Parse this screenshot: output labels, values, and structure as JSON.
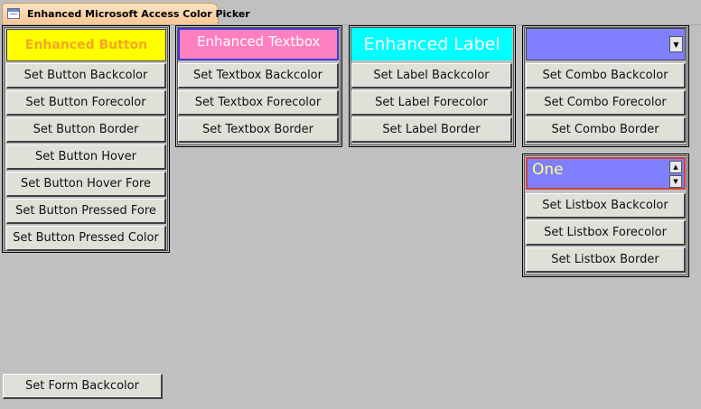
{
  "tab": {
    "title": "Enhanced Microsoft Access Color Picker"
  },
  "colors": {
    "button_bg": "#ffff00",
    "button_fg": "#f5a623",
    "textbox_bg": "#ff80c0",
    "textbox_fg": "#ffffff",
    "textbox_border": "#3a3ad0",
    "label_bg": "#00ffff",
    "label_fg": "#ffffff",
    "combo_bg": "#8080ff",
    "listbox_bg": "#8080ff",
    "listbox_fg": "#ffff80",
    "listbox_border": "#d04040",
    "form_bg": "#c0c0c0"
  },
  "button_panel": {
    "demo": "Enhanced Button",
    "buttons": [
      "Set Button Backcolor",
      "Set Button Forecolor",
      "Set Button Border",
      "Set Button Hover",
      "Set Button Hover Fore",
      "Set Button Pressed Fore",
      "Set Button Pressed Color"
    ]
  },
  "textbox_panel": {
    "demo": "Enhanced Textbox",
    "buttons": [
      "Set Textbox Backcolor",
      "Set Textbox Forecolor",
      "Set Textbox Border"
    ]
  },
  "label_panel": {
    "demo": "Enhanced Label",
    "buttons": [
      "Set Label Backcolor",
      "Set Label Forecolor",
      "Set Label Border"
    ]
  },
  "combo_panel": {
    "value": "",
    "buttons": [
      "Set Combo Backcolor",
      "Set Combo Forecolor",
      "Set Combo Border"
    ]
  },
  "listbox_panel": {
    "items": [
      "One"
    ],
    "buttons": [
      "Set Listbox Backcolor",
      "Set Listbox Forecolor",
      "Set Listbox Border"
    ]
  },
  "form": {
    "set_backcolor_label": "Set Form Backcolor"
  }
}
